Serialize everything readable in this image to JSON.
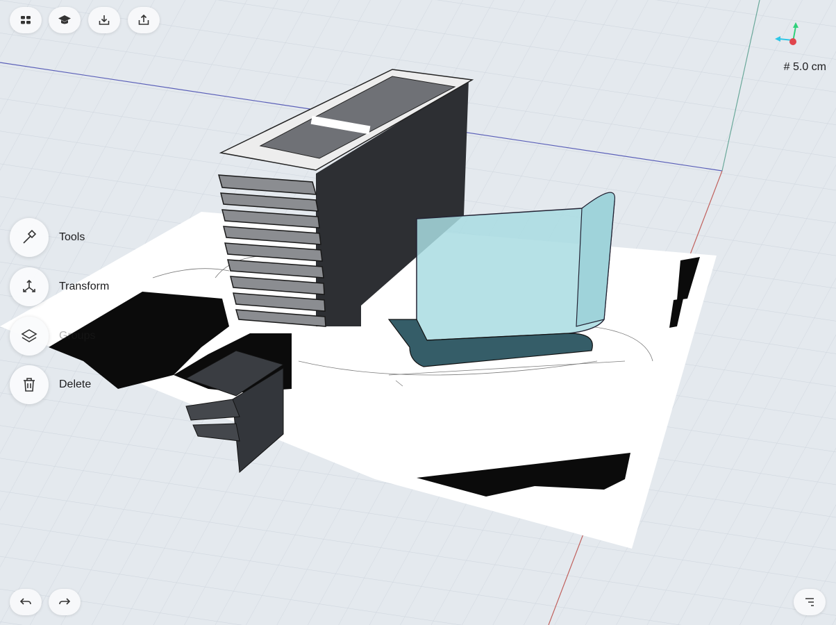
{
  "toolbar": {
    "items": [
      {
        "id": "menu",
        "icon": "grid-menu-icon"
      },
      {
        "id": "learn",
        "icon": "graduation-cap-icon"
      },
      {
        "id": "import",
        "icon": "import-tray-icon"
      },
      {
        "id": "export",
        "icon": "export-share-icon"
      }
    ]
  },
  "side_tools": [
    {
      "label": "Tools",
      "icon": "hammer-icon"
    },
    {
      "label": "Transform",
      "icon": "transform-arrows-icon"
    },
    {
      "label": "Groups",
      "icon": "layers-icon"
    },
    {
      "label": "Delete",
      "icon": "trash-icon"
    }
  ],
  "grid_scale": "# 5.0 cm",
  "axis_colors": {
    "x": "#e0454d",
    "y": "#2fd07a",
    "z": "#2ec6e6"
  },
  "bottom_controls": {
    "undo_icon": "undo-icon",
    "redo_icon": "redo-icon",
    "outline_icon": "outliner-icon"
  }
}
